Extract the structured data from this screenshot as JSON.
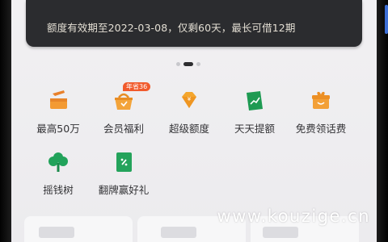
{
  "banner": {
    "text": "额度有效期至2022-03-08，仅剩60天，最长可借12期"
  },
  "carousel": {
    "page_count": 3,
    "active_index": 1
  },
  "services": [
    {
      "id": "max50w",
      "label": "最高50万",
      "icon": "pickaxe-icon",
      "color": "#f0962c"
    },
    {
      "id": "member",
      "label": "会员福利",
      "icon": "gift-basket-icon",
      "color": "#f3a43a",
      "badge": "年省36"
    },
    {
      "id": "super",
      "label": "超级额度",
      "icon": "diamond-coin-icon",
      "color": "#f4a62d"
    },
    {
      "id": "daily",
      "label": "天天提额",
      "icon": "trend-card-icon",
      "color": "#1e9a52"
    },
    {
      "id": "phone",
      "label": "免费领话费",
      "icon": "gift-box-icon",
      "color": "#f3a037"
    },
    {
      "id": "tree",
      "label": "摇钱树",
      "icon": "tree-icon",
      "color": "#21a25a"
    },
    {
      "id": "flip",
      "label": "翻牌赢好礼",
      "icon": "card-icon",
      "color": "#24a35b"
    }
  ],
  "watermark": "www.kouzige.cn"
}
